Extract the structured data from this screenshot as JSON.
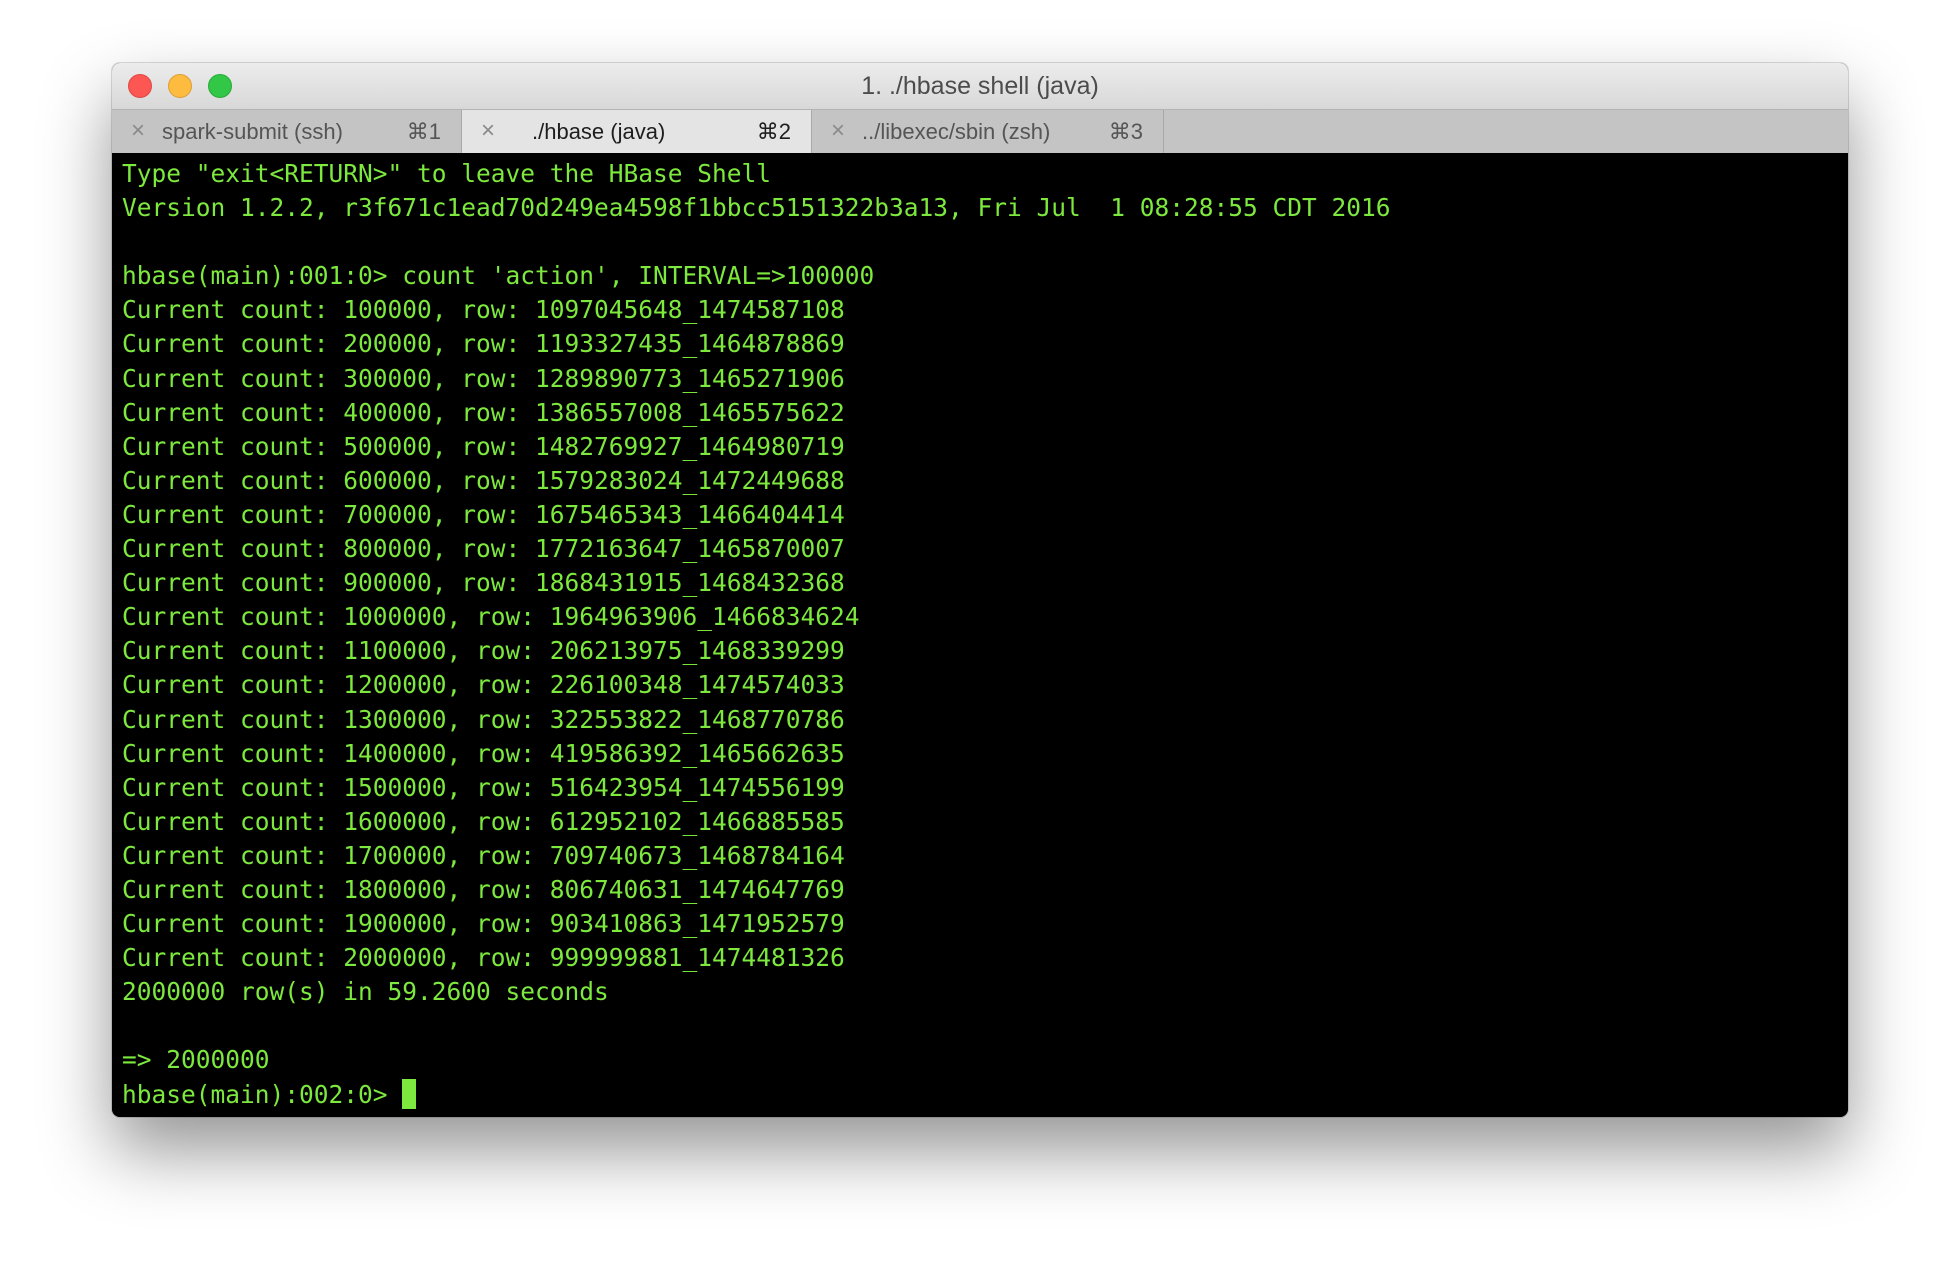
{
  "window": {
    "title": "1. ./hbase shell (java)"
  },
  "tabs": [
    {
      "label": "spark-submit (ssh)",
      "shortcut": "⌘1",
      "active": false
    },
    {
      "label": "./hbase (java)",
      "shortcut": "⌘2",
      "active": true
    },
    {
      "label": "../libexec/sbin (zsh)",
      "shortcut": "⌘3",
      "active": false
    }
  ],
  "terminal": {
    "text_color": "#7de83d",
    "background_color": "#000000",
    "lines": [
      "Type \"exit<RETURN>\" to leave the HBase Shell",
      "Version 1.2.2, r3f671c1ead70d249ea4598f1bbcc5151322b3a13, Fri Jul  1 08:28:55 CDT 2016",
      "",
      "hbase(main):001:0> count 'action', INTERVAL=>100000",
      "Current count: 100000, row: 1097045648_1474587108",
      "Current count: 200000, row: 1193327435_1464878869",
      "Current count: 300000, row: 1289890773_1465271906",
      "Current count: 400000, row: 1386557008_1465575622",
      "Current count: 500000, row: 1482769927_1464980719",
      "Current count: 600000, row: 1579283024_1472449688",
      "Current count: 700000, row: 1675465343_1466404414",
      "Current count: 800000, row: 1772163647_1465870007",
      "Current count: 900000, row: 1868431915_1468432368",
      "Current count: 1000000, row: 1964963906_1466834624",
      "Current count: 1100000, row: 206213975_1468339299",
      "Current count: 1200000, row: 226100348_1474574033",
      "Current count: 1300000, row: 322553822_1468770786",
      "Current count: 1400000, row: 419586392_1465662635",
      "Current count: 1500000, row: 516423954_1474556199",
      "Current count: 1600000, row: 612952102_1466885585",
      "Current count: 1700000, row: 709740673_1468784164",
      "Current count: 1800000, row: 806740631_1474647769",
      "Current count: 1900000, row: 903410863_1471952579",
      "Current count: 2000000, row: 999999881_1474481326",
      "2000000 row(s) in 59.2600 seconds",
      "",
      "=> 2000000"
    ],
    "prompt": "hbase(main):002:0>"
  }
}
